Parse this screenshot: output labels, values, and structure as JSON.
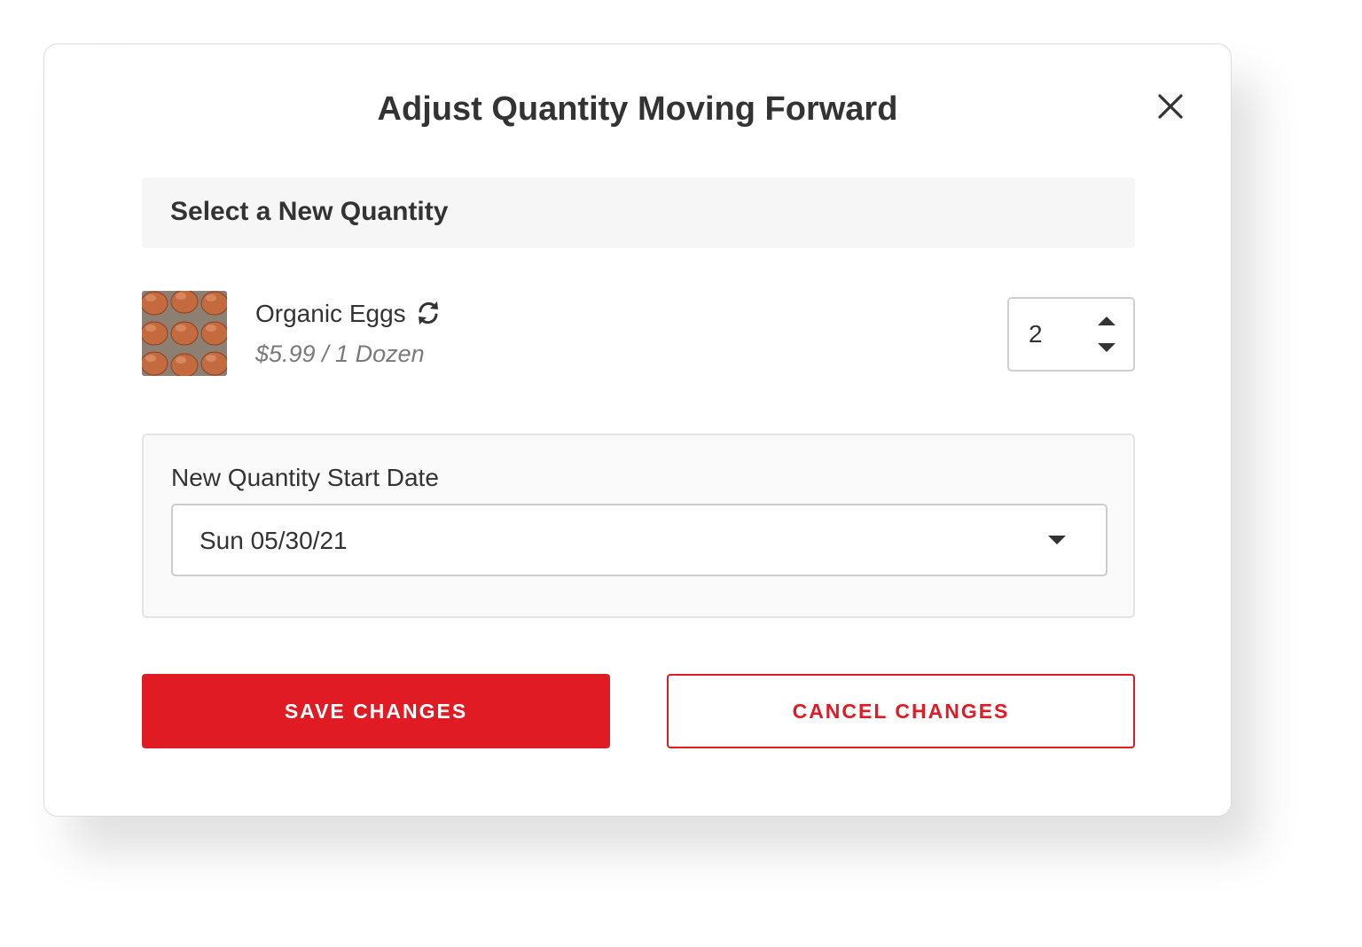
{
  "modal": {
    "title": "Adjust Quantity Moving Forward"
  },
  "section": {
    "header": "Select a New Quantity"
  },
  "product": {
    "name": "Organic Eggs",
    "price": "$5.99 / 1 Dozen",
    "image_icon": "eggs-photo",
    "subscription_icon": "refresh-icon"
  },
  "quantity": {
    "value": "2"
  },
  "start_date": {
    "label": "New Quantity Start Date",
    "selected": "Sun 05/30/21"
  },
  "actions": {
    "save_label": "SAVE CHANGES",
    "cancel_label": "CANCEL CHANGES"
  },
  "colors": {
    "accent": "#e11b24",
    "text": "#333333",
    "muted": "#7a7a7a",
    "panel_bg": "#f6f6f6"
  }
}
